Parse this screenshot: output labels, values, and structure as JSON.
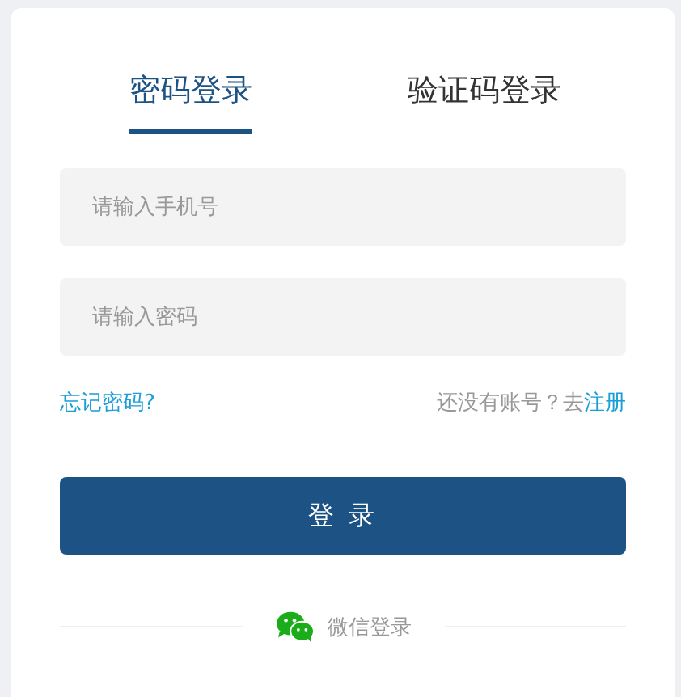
{
  "tabs": [
    {
      "label": "密码登录",
      "selected": true
    },
    {
      "label": "验证码登录",
      "selected": false
    }
  ],
  "fields": [
    {
      "placeholder": "请输入手机号"
    },
    {
      "placeholder": "请输入密码"
    }
  ],
  "forgot_link": "忘记密码?",
  "register": {
    "prompt": "还没有账号？去",
    "link": "注册"
  },
  "login_button": "登 录",
  "wechat_login": "微信登录"
}
